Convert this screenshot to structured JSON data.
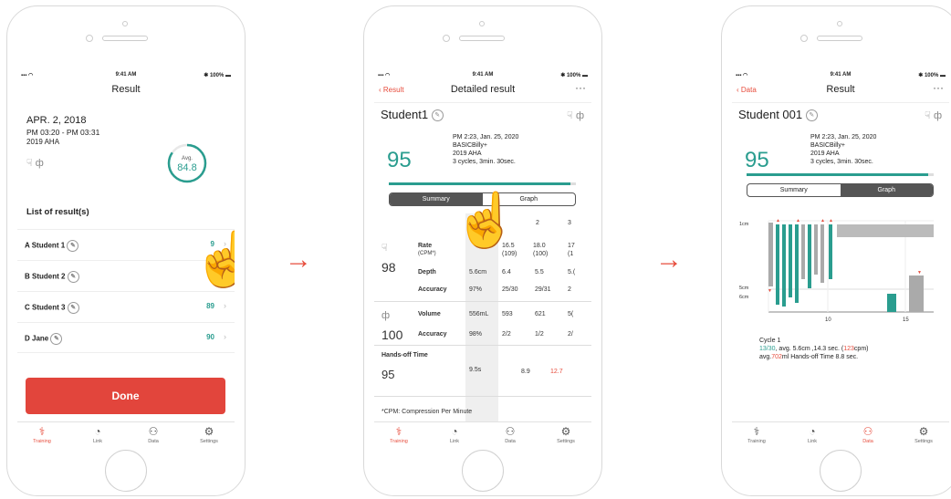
{
  "status": {
    "time": "9:41 AM",
    "battery": "100%"
  },
  "arrows": [
    "→",
    "→"
  ],
  "screen1": {
    "title": "Result",
    "date": "APR. 2, 2018",
    "time_range": "PM 03:20 - PM 03:31",
    "guideline": "2019 AHA",
    "avg_label": "Avg.",
    "avg_value": "84.8",
    "avg_fraction": 0.848,
    "list_title": "List of result(s)",
    "rows": [
      {
        "name": "A Student 1",
        "score": "9"
      },
      {
        "name": "B Student 2",
        "score": ""
      },
      {
        "name": "C Student 3",
        "score": "89"
      },
      {
        "name": "D Jane",
        "score": "90"
      }
    ],
    "done": "Done",
    "tabs": [
      "Training",
      "Link",
      "Data",
      "Settings"
    ]
  },
  "screen2": {
    "back": "Result",
    "title": "Detailed result",
    "student": "Student1",
    "score": "95",
    "meta": [
      "PM 2:23, Jan. 25, 2020",
      "BASICBilly+",
      "2019 AHA",
      "3 cycles, 3min. 30sec."
    ],
    "progress": 0.97,
    "seg": [
      "Summary",
      "Graph"
    ],
    "cols": [
      "2",
      "3"
    ],
    "comp_score": "98",
    "rate_label": "Rate",
    "rate_unit": "(CPM*)",
    "rate_vals": [
      "16.5",
      "(109)",
      "18.0",
      "(100)",
      "17",
      "(1"
    ],
    "depth_label": "Depth",
    "depth_vals": [
      "5.6cm",
      "6.4",
      "5.5",
      "5.("
    ],
    "accuracy_label": "Accuracy",
    "acc_vals": [
      "97%",
      "25/30",
      "29/31",
      "2"
    ],
    "vent_score": "100",
    "volume_label": "Volume",
    "vol_vals": [
      "556mL",
      "593",
      "621",
      "5("
    ],
    "vacc_label": "Accuracy",
    "vacc_vals": [
      "98%",
      "2/2",
      "1/2",
      "2/"
    ],
    "handsoff_label": "Hands-off Time",
    "handsoff_score": "95",
    "handsoff_vals": [
      "9.5s",
      "8.9",
      "12.7"
    ],
    "footnote": "*CPM: Compression Per Minute",
    "tabs": [
      "Training",
      "Link",
      "Data",
      "Settings"
    ]
  },
  "screen3": {
    "back": "Data",
    "title": "Result",
    "student": "Student 001",
    "score": "95",
    "meta": [
      "PM 2:23, Jan. 25, 2020",
      "BASICBilly+",
      "2019 AHA",
      "3 cycles, 3min. 30sec."
    ],
    "progress": 0.97,
    "seg": [
      "Summary",
      "Graph"
    ],
    "y_labels": [
      "1cm",
      "5cm",
      "6cm"
    ],
    "x_labels": [
      "10",
      "15"
    ],
    "cycle_title": "Cycle 1",
    "cycle_l2a": "13/30",
    "cycle_l2b": ", avg. 5.6cm ,14.3 sec. (",
    "cycle_l2c": "123",
    "cycle_l2d": "cpm)",
    "cycle_l3a": "avg.",
    "cycle_l3b": "702",
    "cycle_l3c": "ml Hands-off Time 8.8 sec.",
    "tabs": [
      "Training",
      "Link",
      "Data",
      "Settings"
    ]
  }
}
